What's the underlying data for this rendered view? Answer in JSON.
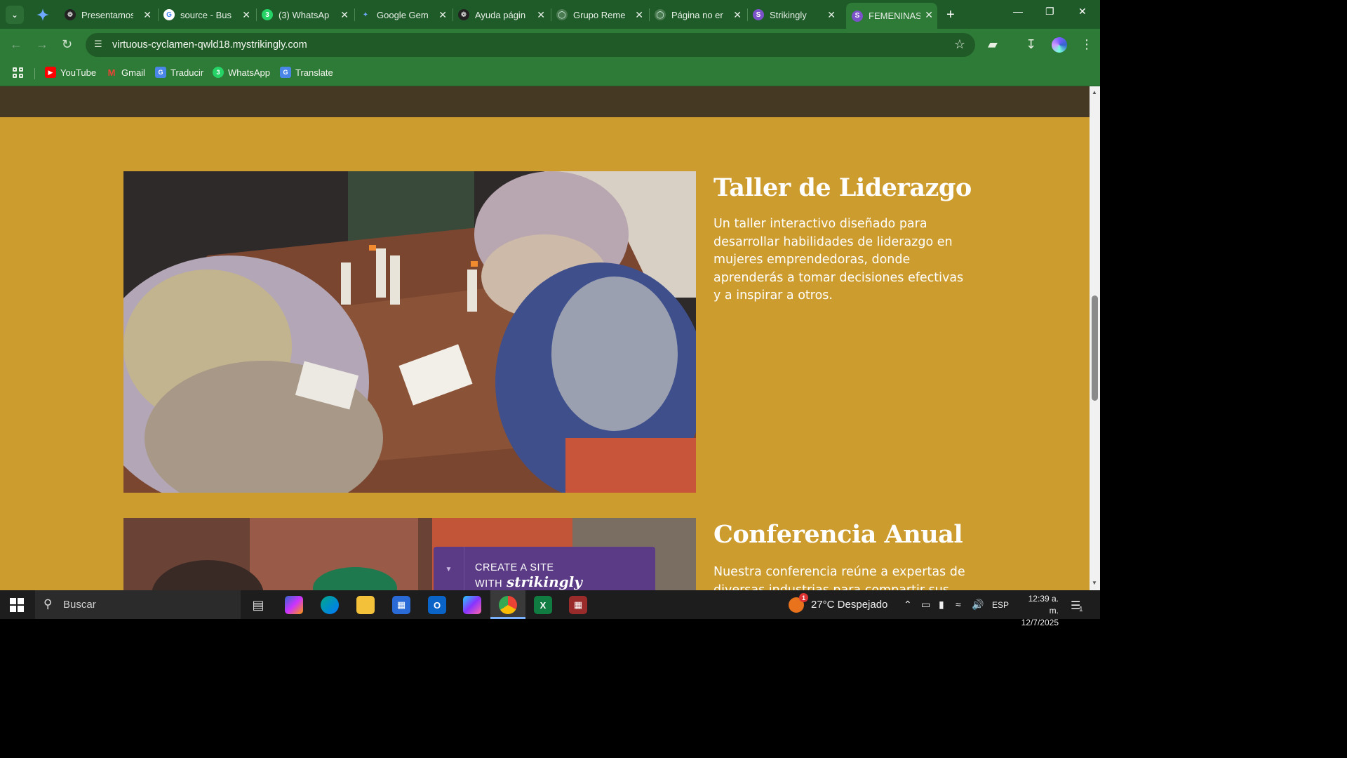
{
  "browser": {
    "tabs": [
      {
        "title": "Presentamos",
        "icon": "openai-icon"
      },
      {
        "title": "source - Bus",
        "icon": "google-icon"
      },
      {
        "title": "(3) WhatsAp",
        "icon": "whatsapp-icon"
      },
      {
        "title": "Google Gem",
        "icon": "gemini-icon"
      },
      {
        "title": "Ayuda págin",
        "icon": "openai-icon"
      },
      {
        "title": "Grupo Reme",
        "icon": "globe-icon"
      },
      {
        "title": "Página no er",
        "icon": "globe-icon"
      },
      {
        "title": "Strikingly",
        "icon": "strikingly-icon"
      },
      {
        "title": "FEMENINAS",
        "icon": "strikingly-icon",
        "active": true
      }
    ],
    "url": "virtuous-cyclamen-qwld18.mystrikingly.com",
    "bookmarks": [
      {
        "label": "YouTube",
        "icon": "youtube-icon"
      },
      {
        "label": "Gmail",
        "icon": "gmail-icon"
      },
      {
        "label": "Traducir",
        "icon": "translate-icon"
      },
      {
        "label": "WhatsApp",
        "icon": "whatsapp-icon"
      },
      {
        "label": "Translate",
        "icon": "translate-icon"
      }
    ]
  },
  "page": {
    "section1": {
      "title": "Taller de Liderazgo",
      "body": "Un taller interactivo diseñado para desarrollar habilidades de liderazgo en mujeres emprendedoras, donde aprenderás a tomar decisiones efectivas y a inspirar a otros."
    },
    "section2": {
      "title": "Conferencia Anual",
      "body": "Nuestra conferencia reúne a expertas de diversas industrias para compartir sus"
    },
    "banner": {
      "text": "CREATE A SITE WITH",
      "brand": "strikingly"
    },
    "colors": {
      "section_bg": "#cd9c2e",
      "top_band": "#463924",
      "banner_bg": "#5b3b86",
      "browser_accent": "#2e7a37"
    }
  },
  "taskbar": {
    "search_placeholder": "Buscar",
    "weather": "27°C  Despejado",
    "weather_badge": "1",
    "language": "ESP",
    "time": "12:39 a. m.",
    "date": "12/7/2025",
    "notification_count": "1"
  }
}
